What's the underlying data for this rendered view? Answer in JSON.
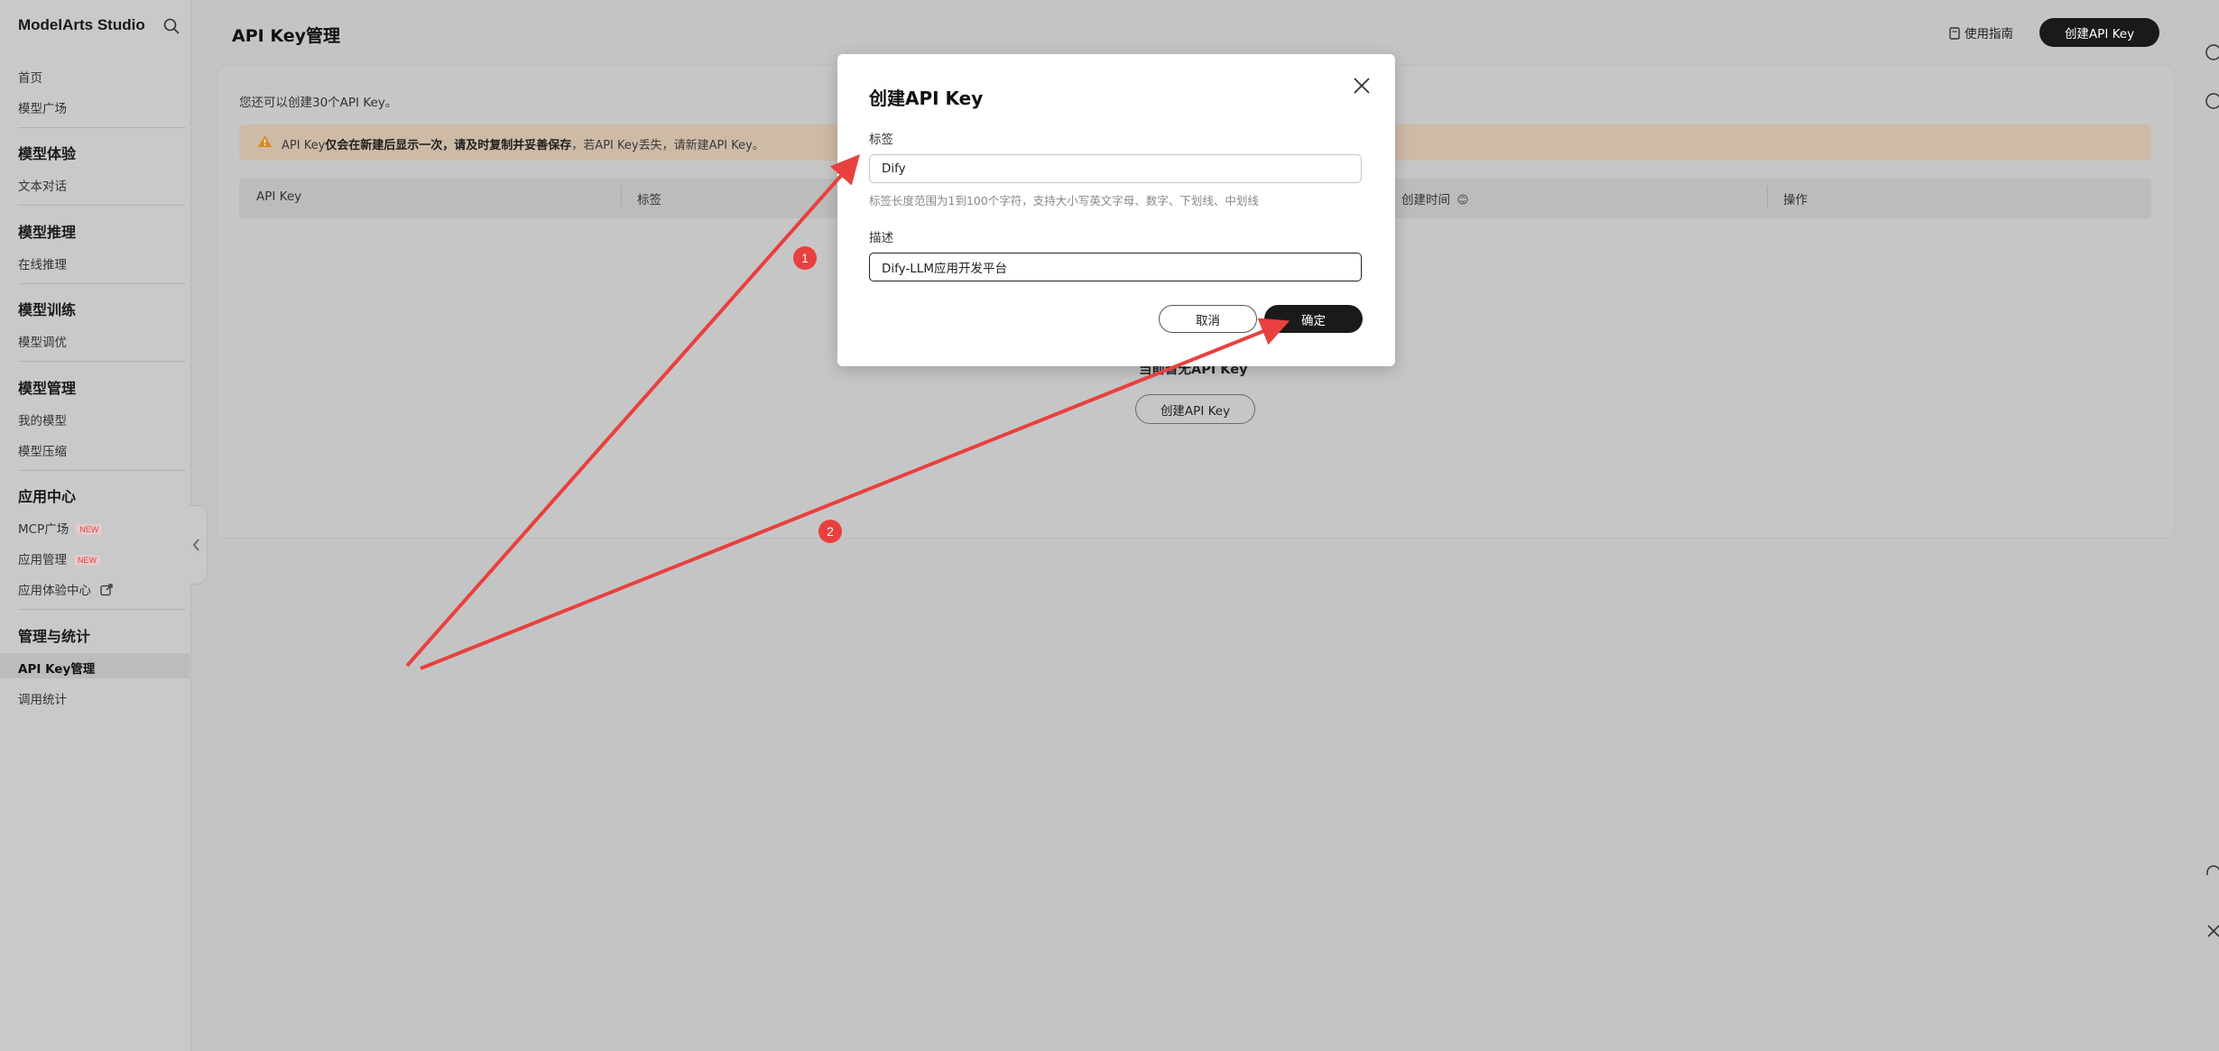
{
  "sidebar": {
    "brand": "ModelArts Studio",
    "top_items": [
      "首页",
      "模型广场"
    ],
    "sections": [
      {
        "title": "模型体验",
        "items": [
          "文本对话"
        ]
      },
      {
        "title": "模型推理",
        "items": [
          "在线推理"
        ]
      },
      {
        "title": "模型训练",
        "items": [
          "模型调优"
        ]
      },
      {
        "title": "模型管理",
        "items": [
          "我的模型",
          "模型压缩"
        ]
      },
      {
        "title": "应用中心",
        "items": [
          "MCP广场",
          "应用管理",
          "应用体验中心"
        ]
      },
      {
        "title": "管理与统计",
        "items": [
          "API Key管理",
          "调用统计"
        ]
      }
    ],
    "new_badge": "NEW",
    "active_item": "API Key管理"
  },
  "header": {
    "title": "API Key管理",
    "guide_label": "使用指南",
    "create_label": "创建API Key"
  },
  "main": {
    "quota_text": "您还可以创建30个API Key。",
    "warning": {
      "prefix": "API Key",
      "bold": "仅会在新建后显示一次，请及时复制并妥善保存",
      "suffix": "，若API Key丢失，请新建API Key。"
    },
    "table": {
      "columns": [
        "API Key",
        "标签",
        "创建时间",
        "操作"
      ]
    },
    "empty_text": "当前暂无API Key",
    "empty_create_label": "创建API Key"
  },
  "modal": {
    "title": "创建API Key",
    "tag_label": "标签",
    "tag_value": "Dify",
    "tag_hint": "标签长度范围为1到100个字符，支持大小写英文字母、数字、下划线、中划线",
    "desc_label": "描述",
    "desc_value": "Dify-LLM应用开发平台",
    "cancel_label": "取消",
    "ok_label": "确定"
  },
  "annotations": {
    "steps": [
      "1",
      "2"
    ],
    "color": "#e8403f"
  }
}
